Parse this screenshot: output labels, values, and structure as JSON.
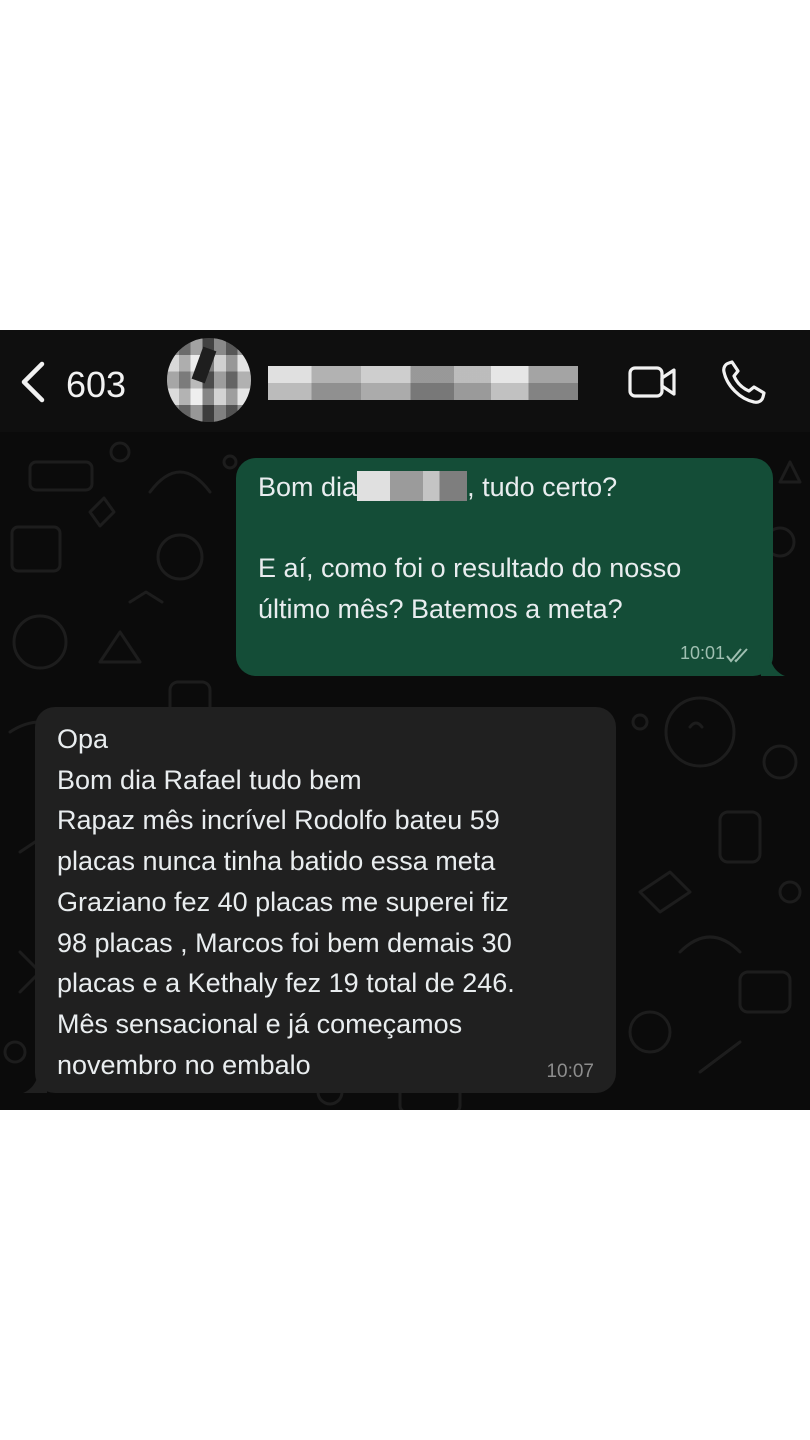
{
  "header": {
    "back_count": "603",
    "icons": {
      "back": "chevron-left-icon",
      "video": "video-camera-icon",
      "call": "phone-icon"
    }
  },
  "messages": [
    {
      "direction": "outgoing",
      "greeting_prefix": "Bom dia",
      "greeting_suffix": ", tudo certo?",
      "line2": "E aí, como foi o resultado do nosso",
      "line3": "último mês? Batemos a meta?",
      "time": "10:01",
      "status": "read-double-check"
    },
    {
      "direction": "incoming",
      "lines": [
        "Opa",
        "Bom dia Rafael tudo bem",
        "Rapaz mês incrível Rodolfo bateu 59",
        "placas nunca tinha batido essa meta",
        "Graziano fez 40 placas me superei fiz",
        "98 placas , Marcos foi bem demais 30",
        "placas e a Kethaly fez 19 total de 246.",
        "Mês sensacional e já começamos",
        "novembro no embalo"
      ],
      "time": "10:07"
    }
  ],
  "colors": {
    "outgoing_bubble": "#144d37",
    "incoming_bubble": "#202020",
    "chat_background": "#0b0b0b"
  }
}
